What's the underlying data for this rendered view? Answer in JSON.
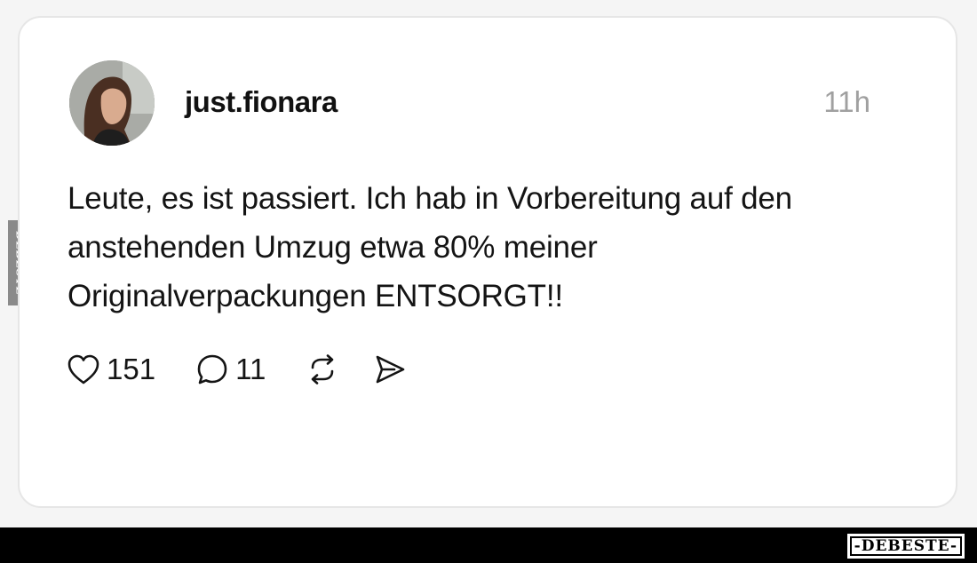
{
  "post": {
    "username": "just.fionara",
    "time": "11h",
    "text": "Leute, es ist passiert. Ich hab in Vorbereitung auf den anstehenden Umzug etwa 80% meiner Originalverpackungen ENTSORGT!!",
    "likes": "151",
    "replies": "11"
  },
  "icons": {
    "like": "heart-icon",
    "reply": "speech-bubble-icon",
    "repost": "repost-icon",
    "share": "send-icon"
  },
  "watermark": {
    "side": "DEBESTE",
    "brand": "-DEBESTE-"
  },
  "colors": {
    "text": "#141414",
    "muted": "#a0a0a0",
    "card_border": "#e6e6e6",
    "footer": "#000000"
  }
}
